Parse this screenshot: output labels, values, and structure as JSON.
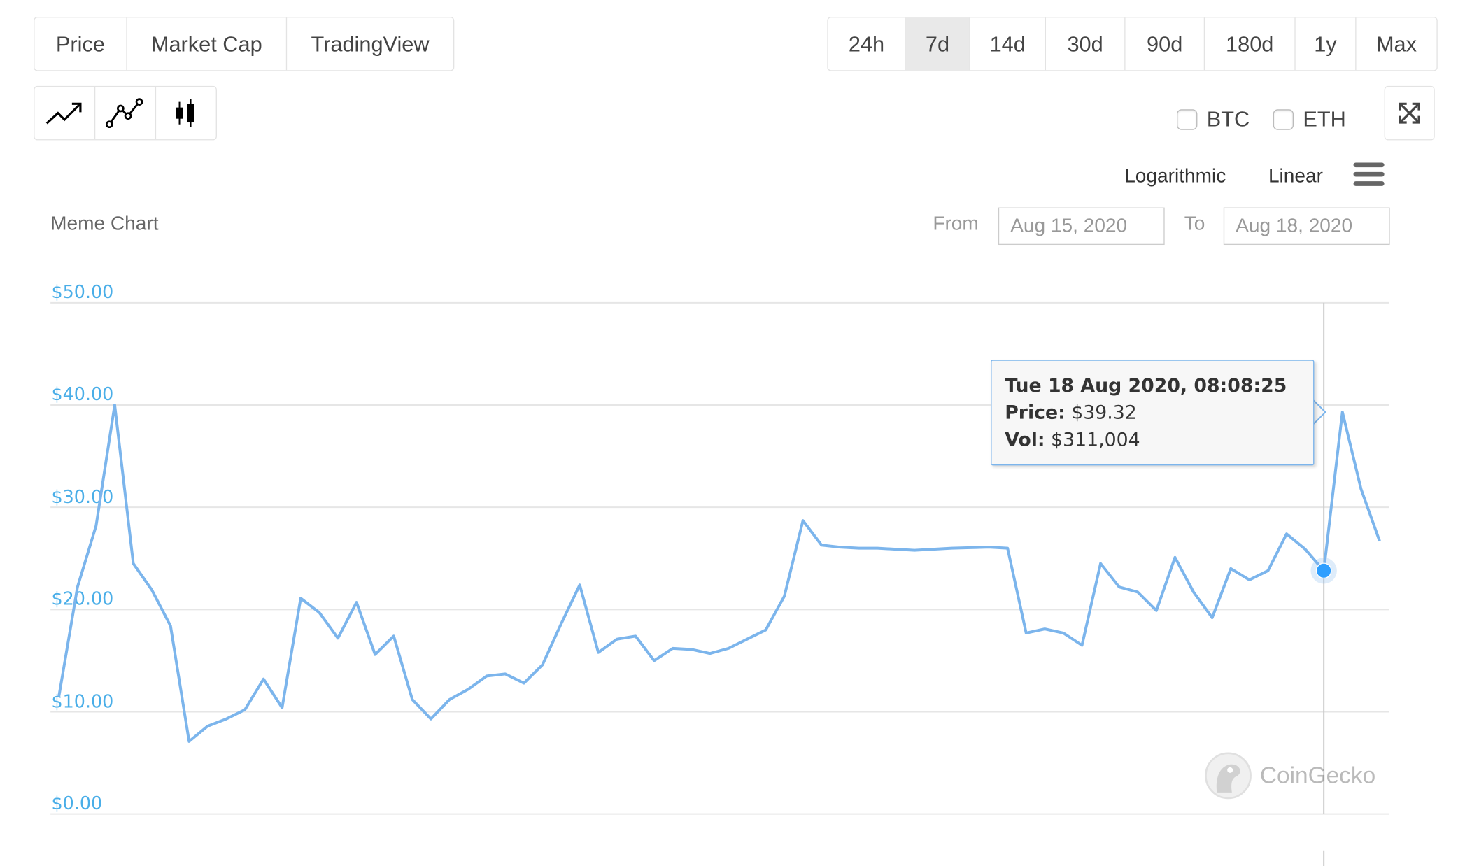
{
  "tabs": [
    {
      "label": "Price",
      "active": true
    },
    {
      "label": "Market Cap",
      "active": false
    },
    {
      "label": "TradingView",
      "active": false
    }
  ],
  "ranges": [
    {
      "label": "24h",
      "active": false
    },
    {
      "label": "7d",
      "active": true
    },
    {
      "label": "14d",
      "active": false
    },
    {
      "label": "30d",
      "active": false
    },
    {
      "label": "90d",
      "active": false
    },
    {
      "label": "180d",
      "active": false
    },
    {
      "label": "1y",
      "active": false
    },
    {
      "label": "Max",
      "active": false
    }
  ],
  "chart_types": [
    {
      "icon": "line-chart-icon",
      "active": true
    },
    {
      "icon": "line-points-chart-icon",
      "active": false
    },
    {
      "icon": "candlestick-chart-icon",
      "active": false
    }
  ],
  "compare": [
    {
      "label": "BTC",
      "checked": false
    },
    {
      "label": "ETH",
      "checked": false
    }
  ],
  "fullscreen_icon": "expand-icon",
  "scale": {
    "log_label": "Logarithmic",
    "linear_label": "Linear",
    "menu_icon": "hamburger-menu-icon"
  },
  "range_picker": {
    "from_label": "From",
    "from_value": "Aug 15, 2020",
    "to_label": "To",
    "to_value": "Aug 18, 2020"
  },
  "tooltip": {
    "date": "Tue 18 Aug 2020, 08:08:25",
    "price_label": "Price:",
    "price_value": "$39.32",
    "vol_label": "Vol:",
    "vol_value": "$311,004"
  },
  "watermark": "CoinGecko",
  "colors": {
    "line": "#7cb5ec",
    "axis_labels": "#4aaee8",
    "marker": "#2f9fff",
    "grid": "#e6e6e6"
  },
  "chart_data": {
    "type": "line",
    "title": "Meme Chart",
    "yticks": [
      "$0.00",
      "$10.00",
      "$20.00",
      "$30.00",
      "$40.00",
      "$50.00"
    ],
    "ylim": [
      0,
      50
    ],
    "xrange": [
      "Aug 15, 2020",
      "Aug 18, 2020"
    ],
    "grid": true,
    "highlight_index": 68,
    "values": [
      11.5,
      22.2,
      28.2,
      40.0,
      24.5,
      21.9,
      18.4,
      7.1,
      8.6,
      9.3,
      10.2,
      13.2,
      10.4,
      21.1,
      19.7,
      17.2,
      20.7,
      15.6,
      17.4,
      11.2,
      9.3,
      11.2,
      12.2,
      13.5,
      13.7,
      12.8,
      14.6,
      18.6,
      22.4,
      15.8,
      17.1,
      17.4,
      15.0,
      16.2,
      16.1,
      15.7,
      16.2,
      17.1,
      18.0,
      21.3,
      28.7,
      26.3,
      26.1,
      26.0,
      26.0,
      25.9,
      25.8,
      25.9,
      26.0,
      26.05,
      26.1,
      26.0,
      17.7,
      18.1,
      17.7,
      16.5,
      24.5,
      22.2,
      21.7,
      19.9,
      25.1,
      21.7,
      19.2,
      24.0,
      22.9,
      23.8,
      27.4,
      25.9,
      23.8,
      39.32,
      31.8,
      26.7
    ]
  }
}
